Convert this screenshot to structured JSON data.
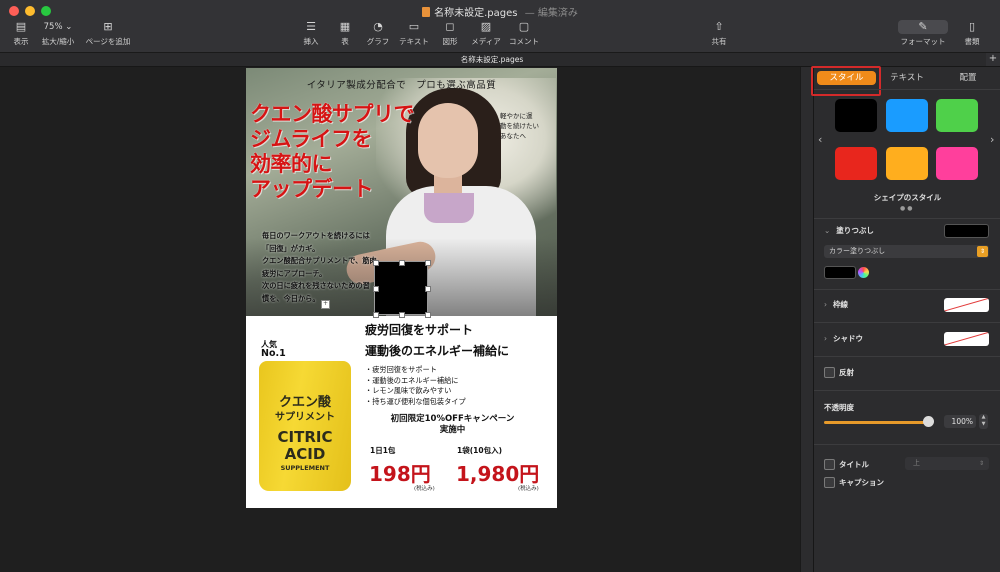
{
  "window": {
    "title": "名称未設定.pages",
    "title_separator": "—",
    "status": "編集済み",
    "tab_title": "名称未設定.pages",
    "tab_add": "+"
  },
  "toolbar": {
    "view": {
      "label": "表示",
      "icon": "sidebar-icon"
    },
    "zoom": {
      "label": "拡大/縮小",
      "value": "75%"
    },
    "add_page": {
      "label": "ページを追加",
      "icon": "plus-square-icon"
    },
    "insert": {
      "label": "挿入",
      "icon": "list-icon"
    },
    "table": {
      "label": "表",
      "icon": "table-icon"
    },
    "chart": {
      "label": "グラフ",
      "icon": "pie-chart-icon"
    },
    "text": {
      "label": "テキスト",
      "icon": "text-box-icon"
    },
    "shape": {
      "label": "図形",
      "icon": "square-icon"
    },
    "media": {
      "label": "メディア",
      "icon": "photo-icon"
    },
    "comment": {
      "label": "コメント",
      "icon": "comment-icon"
    },
    "share": {
      "label": "共有",
      "icon": "share-icon"
    },
    "format": {
      "label": "フォーマット",
      "icon": "paintbrush-icon"
    },
    "document": {
      "label": "書類",
      "icon": "document-icon"
    }
  },
  "flyer": {
    "top_caption": "イタリア製成分配合で　プロも選ぶ高品質",
    "headline": [
      "クエン酸サプリで",
      "ジムライフを",
      "効率的に",
      "アップデート"
    ],
    "side_note": [
      "軽やかに運",
      "動を続けたい",
      "あなたへ"
    ],
    "body": [
      "毎日のワークアウトを続けるには",
      "「回復」がカギ。",
      "クエン酸配合サプリメントで、筋肉",
      "疲労にアプローチ。",
      "次の日に疲れを残さないための習",
      "慣を、今日から。"
    ],
    "rank_label": "人気",
    "rank_value": "No.1",
    "package": {
      "ja1": "クエン酸",
      "ja2": "サプリメント",
      "en1": "CITRIC",
      "en2": "ACID",
      "en3": "SUPPLEMENT"
    },
    "sub_heading_1": "疲労回復をサポート",
    "sub_heading_2": "運動後のエネルギー補給に",
    "bullets": [
      "・疲労回復をサポート",
      "・運動後のエネルギー補給に",
      "・レモン風味で飲みやすい",
      "・持ち運び便利な個包装タイプ"
    ],
    "campaign": [
      "初回限定10%OFFキャンペーン",
      "実施中"
    ],
    "prices": [
      {
        "label": "1日1包",
        "price": "198円",
        "tax": "(税込み)"
      },
      {
        "label": "1袋(10包入)",
        "price": "1,980円",
        "tax": "(税込み)"
      }
    ]
  },
  "inspector": {
    "tabs": [
      "スタイル",
      "テキスト",
      "配置"
    ],
    "active_tab": "スタイル",
    "swatch_colors": [
      "#000000",
      "#1a9cff",
      "#4fd04a",
      "#e8261d",
      "#ffae1e",
      "#ff3f9c"
    ],
    "shape_styles_label": "シェイプのスタイル",
    "fill_label": "塗りつぶし",
    "fill_color": "#000000",
    "fill_type": "カラー塗りつぶし",
    "stroke_label": "枠線",
    "shadow_label": "シャドウ",
    "reflection_label": "反射",
    "opacity_label": "不透明度",
    "opacity_value": "100%",
    "opacity_fraction": 1.0,
    "title_label": "タイトル",
    "title_position": "上",
    "caption_label": "キャプション"
  }
}
